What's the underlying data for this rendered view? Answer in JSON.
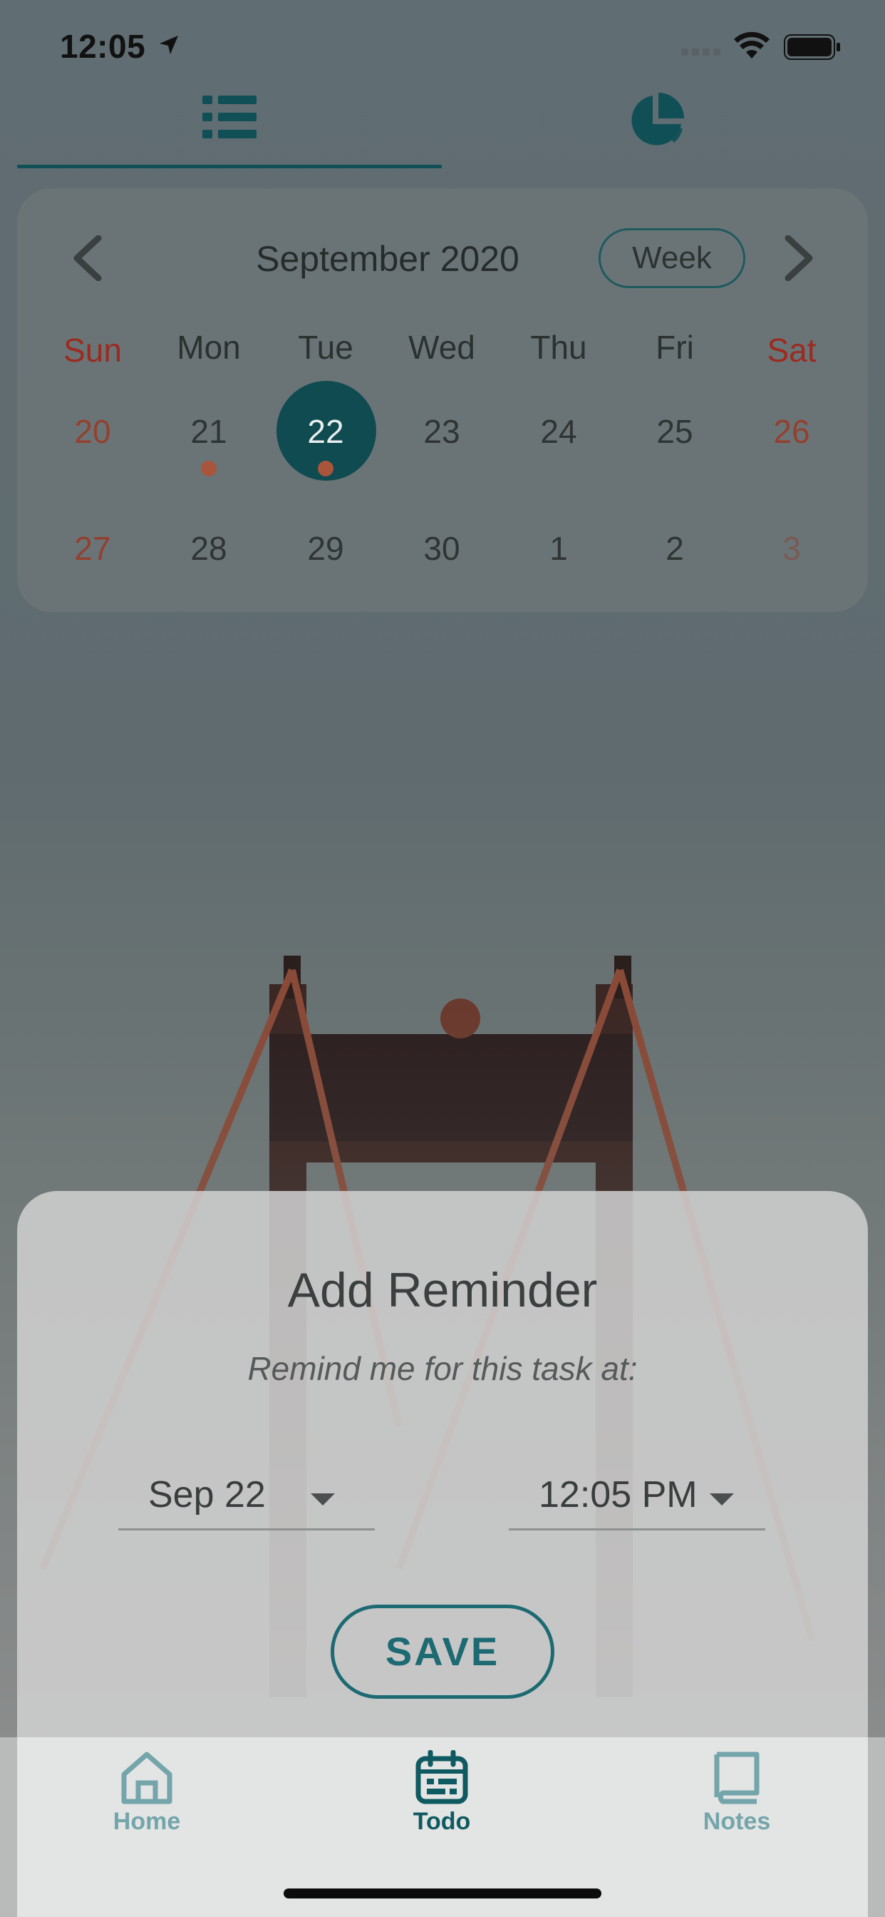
{
  "status_bar": {
    "time": "12:05"
  },
  "top_tabs": {
    "list_icon": "list-icon",
    "chart_icon": "pie-chart-icon",
    "active": "list"
  },
  "calendar": {
    "month_title": "September 2020",
    "format_button": "Week",
    "weekdays": [
      "Sun",
      "Mon",
      "Tue",
      "Wed",
      "Thu",
      "Fri",
      "Sat"
    ],
    "week1": [
      "20",
      "21",
      "22",
      "23",
      "24",
      "25",
      "26"
    ],
    "week2": [
      "27",
      "28",
      "29",
      "30",
      "1",
      "2",
      "3"
    ],
    "selected_day": "22",
    "event_days": [
      "21",
      "22"
    ],
    "colors": {
      "selected": "#0f4b50",
      "weekend": "#9b2b20",
      "event_dot": "#a8553b"
    }
  },
  "reminder_sheet": {
    "title": "Add Reminder",
    "subtitle": "Remind me for this task at:",
    "date_value": "Sep 22",
    "time_value": "12:05 PM",
    "save_label": "SAVE"
  },
  "bottom_nav": {
    "home_label": "Home",
    "todo_label": "Todo",
    "notes_label": "Notes",
    "active": "Todo",
    "colors": {
      "active": "#0f5a60",
      "inactive": "#73a5aa"
    }
  }
}
